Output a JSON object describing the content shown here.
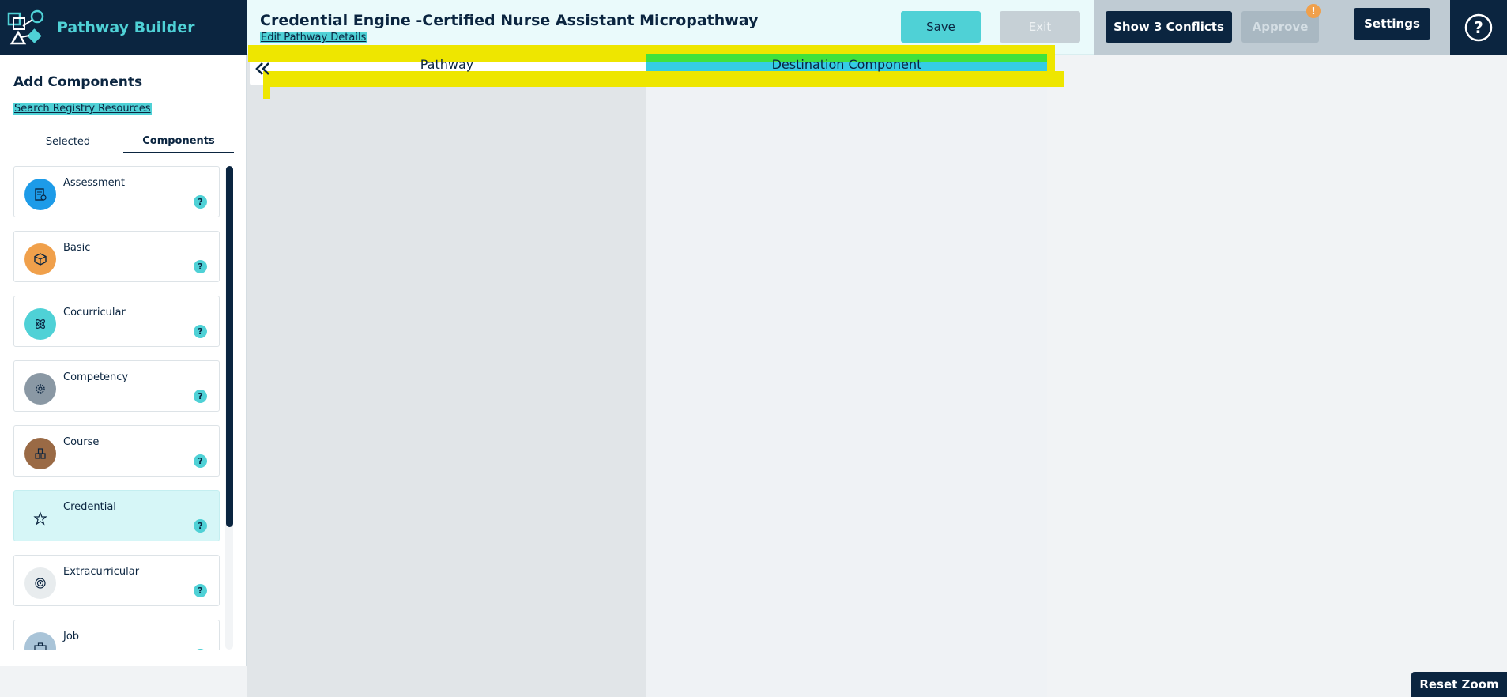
{
  "app": {
    "title": "Pathway Builder"
  },
  "header": {
    "page_title": "Credential Engine -Certified Nurse Assistant Micropathway",
    "edit_link": "Edit Pathway Details",
    "save_label": "Save",
    "exit_label": "Exit",
    "conflicts_label": "Show 3 Conflicts",
    "approve_label": "Approve",
    "approve_badge": "!",
    "settings_label": "Settings",
    "help_icon": "help-icon"
  },
  "sidebar": {
    "title": "Add Components",
    "search_link": "Search Registry Resources",
    "tabs": [
      {
        "label": "Selected"
      },
      {
        "label": "Components",
        "active": true
      }
    ],
    "components": [
      {
        "label": "Assessment",
        "icon": "assessment-icon",
        "color": "#1d9be8",
        "help": "?"
      },
      {
        "label": "Basic",
        "icon": "cube-icon",
        "color": "#f0a04b",
        "help": "?"
      },
      {
        "label": "Cocurricular",
        "icon": "atom-icon",
        "color": "#4fd1d6",
        "help": "?"
      },
      {
        "label": "Competency",
        "icon": "gear-icon",
        "color": "#8a98a4",
        "help": "?"
      },
      {
        "label": "Course",
        "icon": "books-icon",
        "color": "#9a6a45",
        "help": "?"
      },
      {
        "label": "Credential",
        "icon": "star-icon",
        "color": "#d6f6f7",
        "help": "?",
        "active": true
      },
      {
        "label": "Extracurricular",
        "icon": "target-icon",
        "color": "#e8ecee",
        "help": "?"
      },
      {
        "label": "Job",
        "icon": "briefcase-icon",
        "color": "#a9c4d8",
        "help": "?"
      }
    ]
  },
  "canvas": {
    "columns": [
      {
        "label": "Pathway"
      },
      {
        "label": "Destination Component"
      }
    ],
    "collapse_icon": "chevrons-left-icon"
  },
  "footer": {
    "reset_zoom": "Reset Zoom"
  },
  "colors": {
    "navy": "#0b2540",
    "teal": "#4fd1d6",
    "highlight": "#eee600"
  }
}
